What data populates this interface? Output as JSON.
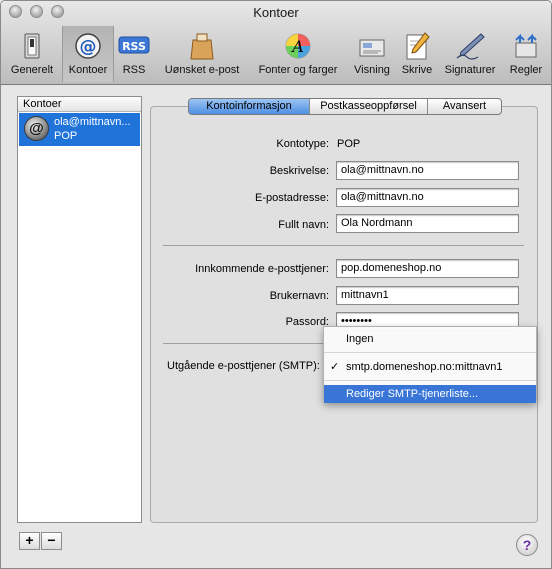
{
  "window": {
    "title": "Kontoer"
  },
  "toolbar": {
    "items": [
      {
        "label": "Generelt",
        "icon": "switch-icon"
      },
      {
        "label": "Kontoer",
        "icon": "at-sign-icon"
      },
      {
        "label": "RSS",
        "icon": "rss-icon"
      },
      {
        "label": "Uønsket e-post",
        "icon": "junk-bag-icon"
      },
      {
        "label": "Fonter og farger",
        "icon": "color-font-icon"
      },
      {
        "label": "Visning",
        "icon": "viewing-icon"
      },
      {
        "label": "Skrive",
        "icon": "compose-pencil-icon"
      },
      {
        "label": "Signaturer",
        "icon": "signature-pen-icon"
      },
      {
        "label": "Regler",
        "icon": "rules-icon"
      }
    ],
    "selected": "Kontoer"
  },
  "sidebar": {
    "header": "Kontoer",
    "accounts": [
      {
        "name": "ola@mittnavn...",
        "type": "POP"
      }
    ]
  },
  "tabs": [
    "Kontoinformasjon",
    "Postkasseoppførsel",
    "Avansert"
  ],
  "account": {
    "type_label": "Kontotype:",
    "type_value": "POP",
    "description_label": "Beskrivelse:",
    "description_value": "ola@mittnavn.no",
    "email_label": "E-postadresse:",
    "email_value": "ola@mittnavn.no",
    "fullname_label": "Fullt navn:",
    "fullname_value": "Ola Nordmann",
    "incoming_label": "Innkommende e-posttjener:",
    "incoming_value": "pop.domeneshop.no",
    "username_label": "Brukernavn:",
    "username_value": "mittnavn1",
    "password_label": "Passord:",
    "password_value": "••••••••",
    "outgoing_label": "Utgående e-posttjener (SMTP):"
  },
  "smtp_menu": {
    "items": [
      "Ingen",
      "smtp.domeneshop.no:mittnavn1",
      "Rediger SMTP-tjenerliste..."
    ],
    "checked": "smtp.domeneshop.no:mittnavn1",
    "highlighted": "Rediger SMTP-tjenerliste..."
  },
  "buttons": {
    "add": "+",
    "remove": "−",
    "help": "?"
  },
  "colors": {
    "selection": "#1f73d9",
    "menu_highlight": "#3875d7",
    "tab_active": "#6aa3ea"
  }
}
